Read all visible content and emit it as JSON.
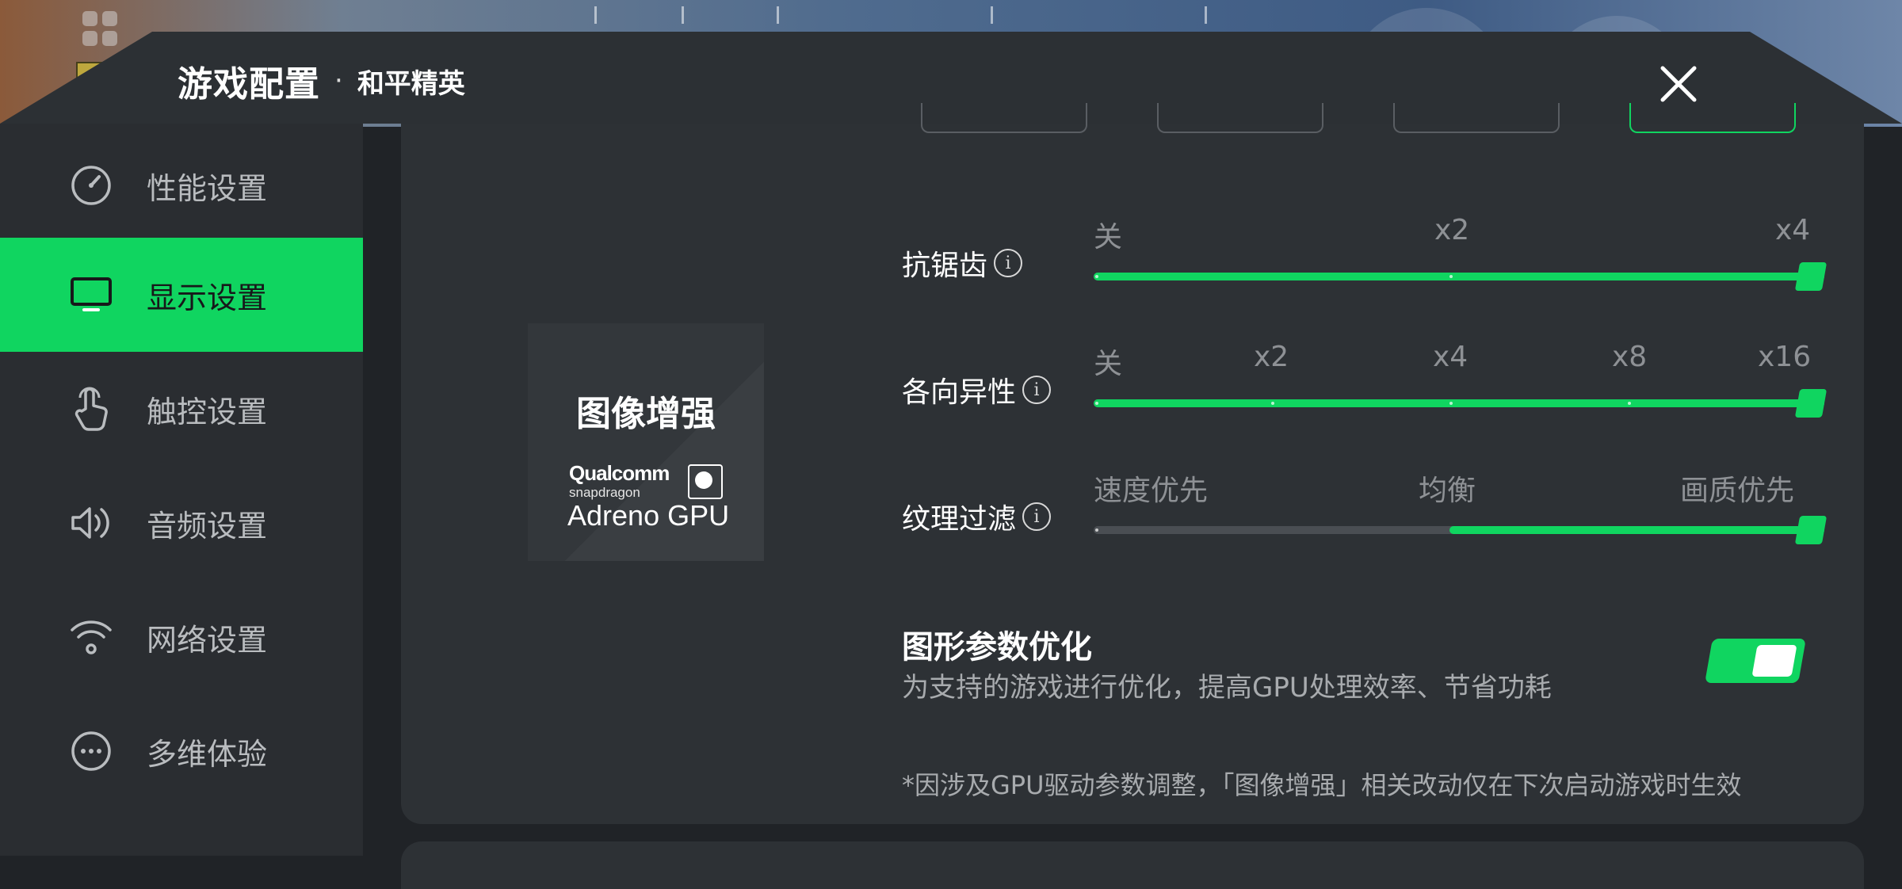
{
  "header": {
    "title": "游戏配置",
    "separator": "·",
    "game_name": "和平精英"
  },
  "sidebar": {
    "items": [
      {
        "label": "性能设置",
        "icon": "gauge-icon",
        "active": false
      },
      {
        "label": "显示设置",
        "icon": "monitor-icon",
        "active": true
      },
      {
        "label": "触控设置",
        "icon": "touch-hand-icon",
        "active": false
      },
      {
        "label": "音频设置",
        "icon": "speaker-icon",
        "active": false
      },
      {
        "label": "网络设置",
        "icon": "wifi-icon",
        "active": false
      },
      {
        "label": "多维体验",
        "icon": "more-dots-icon",
        "active": false
      }
    ]
  },
  "enhance_card": {
    "title": "图像增强",
    "brand": "Qualcomm",
    "brand_sub": "snapdragon",
    "gpu": "Adreno GPU"
  },
  "sliders": {
    "antialias": {
      "label": "抗锯齿",
      "ticks": [
        "关",
        "x2",
        "x4"
      ],
      "selected_index": 2
    },
    "anisotropic": {
      "label": "各向异性",
      "ticks": [
        "关",
        "x2",
        "x4",
        "x8",
        "x16"
      ],
      "selected_index": 4
    },
    "texture": {
      "label": "纹理过滤",
      "ticks": [
        "速度优先",
        "均衡",
        "画质优先"
      ],
      "selected_index": 2,
      "fill_start_index": 1
    }
  },
  "graphics_opt": {
    "title": "图形参数优化",
    "description": "为支持的游戏进行优化，提高GPU处理效率、节省功耗",
    "enabled": true
  },
  "footnote": "*因涉及GPU驱动参数调整，「图像增强」相关改动仅在下次启动游戏时生效",
  "colors": {
    "accent": "#10d560",
    "panel": "#2d3135",
    "sidebar": "#2a2d31"
  }
}
